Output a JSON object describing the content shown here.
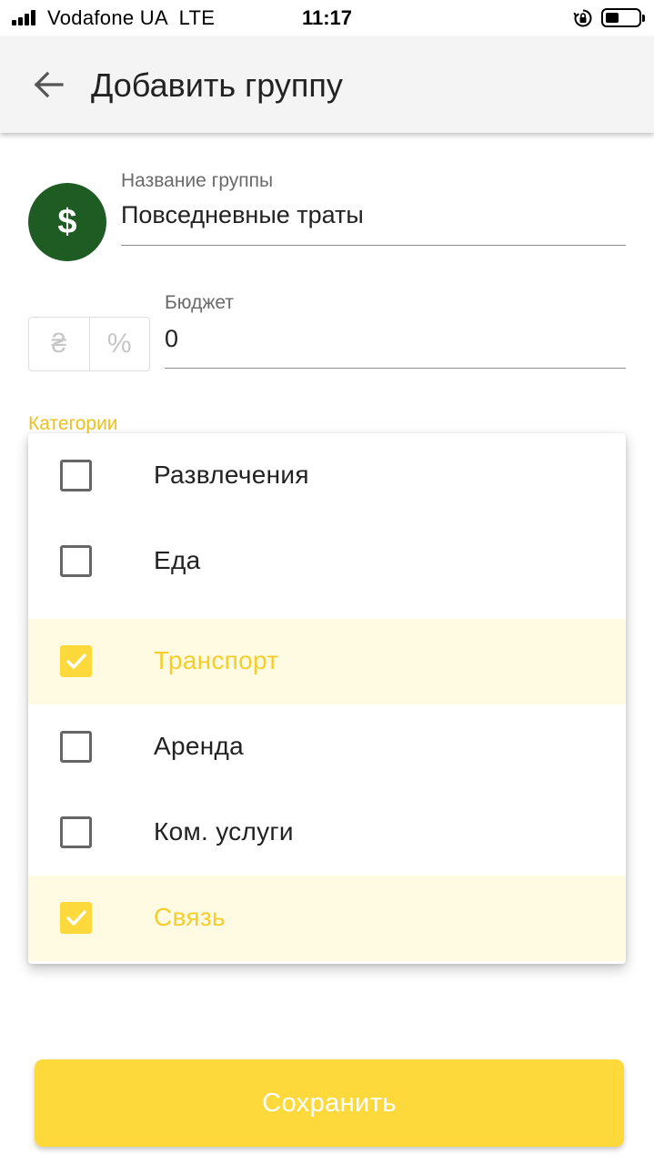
{
  "status_bar": {
    "carrier": "Vodafone UA",
    "network": "LTE",
    "time": "11:17",
    "icons": [
      "signal-icon",
      "rotation-lock-icon",
      "battery-icon"
    ]
  },
  "app_bar": {
    "title": "Добавить группу",
    "back_icon": "arrow-left-icon"
  },
  "group": {
    "icon": "dollar-icon",
    "icon_glyph": "$",
    "icon_color": "#1e5c23",
    "name_label": "Название группы",
    "name_value": "Повседневные траты"
  },
  "budget": {
    "label": "Бюджет",
    "value": "0",
    "mode_options": [
      {
        "glyph": "₴",
        "name": "hryvnia"
      },
      {
        "glyph": "%",
        "name": "percent"
      }
    ]
  },
  "categories": {
    "label": "Категории",
    "accent_color": "#fdd93b",
    "items": [
      {
        "label": "Развлечения",
        "checked": false
      },
      {
        "label": "Еда",
        "checked": false
      },
      {
        "label": "Транспорт",
        "checked": true
      },
      {
        "label": "Аренда",
        "checked": false
      },
      {
        "label": "Ком. услуги",
        "checked": false
      },
      {
        "label": "Связь",
        "checked": true
      }
    ]
  },
  "save_button": {
    "label": "Сохранить",
    "color": "#fdd93b"
  }
}
